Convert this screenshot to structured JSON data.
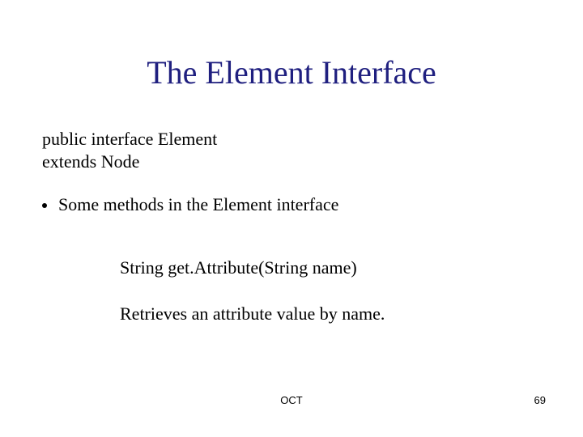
{
  "title": "The Element Interface",
  "code": {
    "line1": "public interface Element",
    "line2": "extends Node"
  },
  "bullet": {
    "text": "Some methods in the Element interface"
  },
  "method": {
    "signature": "String get.Attribute(String name)",
    "description": "Retrieves an attribute value by name."
  },
  "footer": {
    "center": "OCT",
    "page": "69"
  }
}
